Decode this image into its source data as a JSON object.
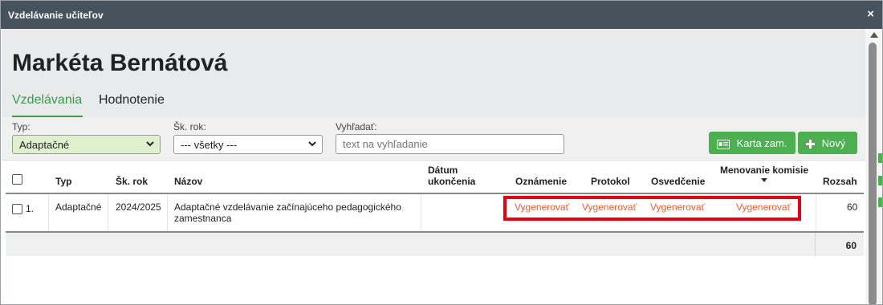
{
  "window": {
    "title": "Vzdelávanie učiteľov",
    "close_icon": "×"
  },
  "header": {
    "name": "Markéta Bernátová",
    "tabs": [
      {
        "label": "Vzdelávania",
        "active": true
      },
      {
        "label": "Hodnotenie",
        "active": false
      }
    ]
  },
  "filters": {
    "typ_label": "Typ:",
    "typ_value": "Adaptačné",
    "rok_label": "Šk. rok:",
    "rok_value": "--- všetky ---",
    "search_label": "Vyhľadať:",
    "search_placeholder": "text na vyhľadanie",
    "karta_button": "Karta zam.",
    "novy_button": "Nový"
  },
  "table": {
    "headers": {
      "typ": "Typ",
      "rok": "Šk. rok",
      "nazov": "Názov",
      "datum_line1": "Dátum",
      "datum_line2": "ukončenia",
      "oznamenie": "Oznámenie",
      "protokol": "Protokol",
      "osvedcenie": "Osvedčenie",
      "menovanie": "Menovanie komisie",
      "rozsah": "Rozsah"
    },
    "rows": [
      {
        "index": "1.",
        "typ": "Adaptačné",
        "rok": "2024/2025",
        "nazov_line1": "Adaptačné vzdelávanie začínajúceho pedagogického",
        "nazov_line2": "zamestnanca",
        "datum": "",
        "oznamenie": "Vygenerovať",
        "protokol": "Vygenerovať",
        "osvedcenie": "Vygenerovať",
        "menovanie": "Vygenerovať",
        "rozsah": "60"
      }
    ],
    "total": "60"
  },
  "colors": {
    "titlebar": "#46525c",
    "accent_green": "#3a9b4c",
    "button_green": "#4caf50",
    "link_orange": "#f25a29",
    "highlight_red": "#e60012"
  }
}
